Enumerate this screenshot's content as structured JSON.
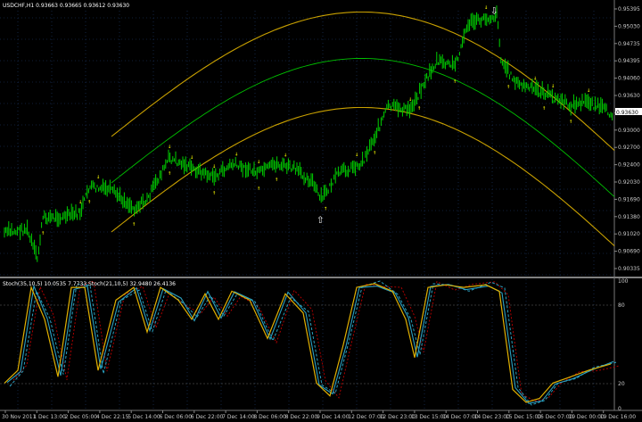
{
  "chart_title": "USDCHF,H1  0.93663 0.93665 0.93612 0.93630",
  "price_axis": [
    "0.95395",
    "0.95030",
    "0.94735",
    "0.94395",
    "0.94060",
    "0.93630",
    "0.93390",
    "0.93000",
    "0.92700",
    "0.92400",
    "0.92030",
    "0.91690",
    "0.91380",
    "0.91020",
    "0.90690",
    "0.90335"
  ],
  "current_price": "0.93630",
  "indicator_title": "Stoch(35,10,5) 10.0535 7.7733  Stoch(21,10,5) 32.9480 26.4136",
  "indicator_axis": [
    "100",
    "80",
    "20",
    "0"
  ],
  "time_axis": [
    "30 Nov 2011",
    "1 Dec 13:00",
    "2 Dec 05:00",
    "4 Dec 22:15",
    "5 Dec 14:00",
    "6 Dec 06:00",
    "6 Dec 22:00",
    "7 Dec 14:00",
    "8 Dec 06:00",
    "8 Dec 22:00",
    "9 Dec 14:00",
    "12 Dec 07:00",
    "12 Dec 23:00",
    "13 Dec 15:00",
    "14 Dec 07:00",
    "14 Dec 23:00",
    "15 Dec 15:00",
    "16 Dec 07:00",
    "19 Dec 00:00",
    "19 Dec 16:00"
  ],
  "colors": {
    "background": "#000000",
    "candles": "#00d000",
    "envelope": "#c8a000",
    "midline": "#00c000",
    "arrows": "#ffff00",
    "signal_arrow": "#ffffff",
    "stoch_main": "#e0b000",
    "stoch_signal": "#2aa0c0",
    "stoch_red": "#c00000",
    "grid": "#1e3c6e"
  },
  "signals": [
    {
      "type": "buy",
      "label": "arrow-up"
    },
    {
      "type": "sell",
      "label": "arrow-down"
    }
  ]
}
